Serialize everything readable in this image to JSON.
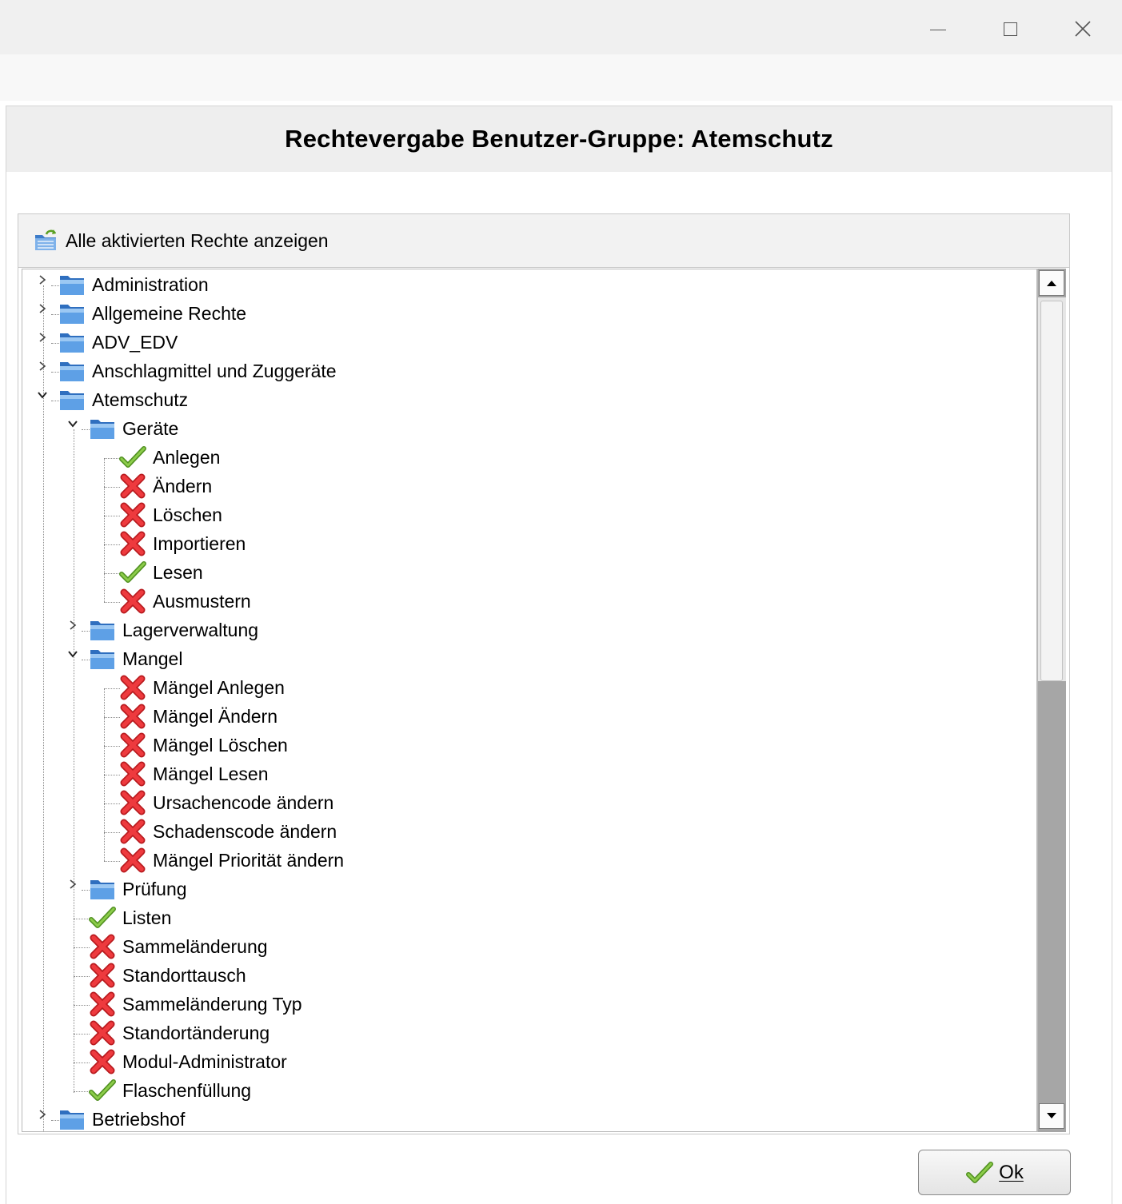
{
  "window": {
    "minimize_glyph": "—",
    "maximize_glyph": "☐",
    "close_glyph": "✕"
  },
  "dialog": {
    "title": "Rechtevergabe Benutzer-Gruppe: Atemschutz",
    "header_action_label": "Alle aktivierten Rechte anzeigen",
    "header_action_icon": "folder-refresh-icon",
    "ok_label": "Ok",
    "ok_icon": "check-icon"
  },
  "tree": {
    "items": [
      {
        "label": "Administration",
        "type": "folder",
        "expander": "collapsed"
      },
      {
        "label": "Allgemeine Rechte",
        "type": "folder",
        "expander": "collapsed"
      },
      {
        "label": "ADV_EDV",
        "type": "folder",
        "expander": "collapsed"
      },
      {
        "label": "Anschlagmittel und Zuggeräte",
        "type": "folder",
        "expander": "collapsed"
      },
      {
        "label": "Atemschutz",
        "type": "folder",
        "expander": "expanded"
      },
      {
        "label": "Geräte",
        "type": "folder",
        "expander": "expanded"
      },
      {
        "label": "Anlegen",
        "type": "allowed"
      },
      {
        "label": "Ändern",
        "type": "denied"
      },
      {
        "label": "Löschen",
        "type": "denied"
      },
      {
        "label": "Importieren",
        "type": "denied"
      },
      {
        "label": "Lesen",
        "type": "allowed"
      },
      {
        "label": "Ausmustern",
        "type": "denied"
      },
      {
        "label": "Lagerverwaltung",
        "type": "folder",
        "expander": "collapsed"
      },
      {
        "label": "Mangel",
        "type": "folder",
        "expander": "expanded"
      },
      {
        "label": "Mängel Anlegen",
        "type": "denied"
      },
      {
        "label": "Mängel Ändern",
        "type": "denied"
      },
      {
        "label": "Mängel Löschen",
        "type": "denied"
      },
      {
        "label": "Mängel Lesen",
        "type": "denied"
      },
      {
        "label": "Ursachencode ändern",
        "type": "denied"
      },
      {
        "label": "Schadenscode ändern",
        "type": "denied"
      },
      {
        "label": "Mängel Priorität ändern",
        "type": "denied"
      },
      {
        "label": "Prüfung",
        "type": "folder",
        "expander": "collapsed"
      },
      {
        "label": "Listen",
        "type": "allowed"
      },
      {
        "label": "Sammeländerung",
        "type": "denied"
      },
      {
        "label": "Standorttausch",
        "type": "denied"
      },
      {
        "label": "Sammeländerung Typ",
        "type": "denied"
      },
      {
        "label": "Standortänderung",
        "type": "denied"
      },
      {
        "label": "Modul-Administrator",
        "type": "denied"
      },
      {
        "label": "Flaschenfüllung",
        "type": "allowed"
      },
      {
        "label": "Betriebshof",
        "type": "folder",
        "expander": "collapsed"
      }
    ],
    "icon_names": {
      "folder": "folder-icon",
      "allowed": "check-icon",
      "denied": "cross-icon"
    }
  },
  "colors": {
    "allowed": "#6aa82a",
    "denied": "#e0282c",
    "folder": "#4a8fd8"
  }
}
